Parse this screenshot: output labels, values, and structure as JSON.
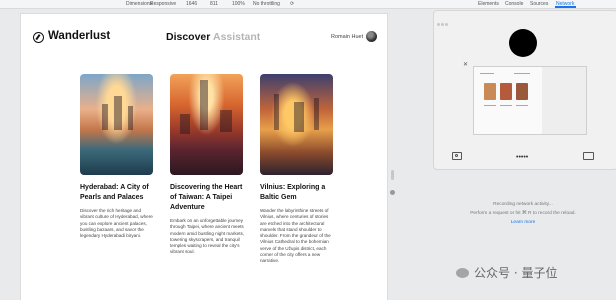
{
  "devtools": {
    "dimensions_label": "Dimensions:",
    "dimensions_value": "Responsive",
    "width": "1646",
    "height": "811",
    "zoom": "100%",
    "throttling": "No throttling",
    "tabs": [
      "Elements",
      "Console",
      "Sources",
      "Network"
    ],
    "active_tab": "Network"
  },
  "site": {
    "brand": "Wanderlust",
    "nav": {
      "discover": "Discover",
      "assistant": "Assistant"
    },
    "user": "Romain Huet"
  },
  "cards": [
    {
      "title": "Hyderabad: A City of Pearls and Palaces",
      "description": "Discover the rich heritage and vibrant culture of Hyderabad, where you can explore ancient palaces, bustling bazaars, and savor the legendary Hyderabadi biryani."
    },
    {
      "title": "Discovering the Heart of Taiwan: A Taipei Adventure",
      "description": "Embark on an unforgettable journey through Taipei, where ancient meets modern amid bustling night markets, towering skyscrapers, and tranquil temples waiting to reveal the city's vibrant soul."
    },
    {
      "title": "Vilnius: Exploring a Baltic Gem",
      "description": "Wander the labyrinthine streets of Vilnius, where centuries of stories are etched into the architectural marvels that stand shoulder to shoulder. From the grandeur of the Vilnius Cathedral to the bohemian verve of the Užupis district, each corner of the city offers a new narrative."
    }
  ],
  "network_panel": {
    "recording": "Recording network activity...",
    "hint": "Perform a request or hit ⌘ R to record the reload.",
    "learn_more": "Learn more"
  },
  "watermark": {
    "text": "公众号 · 量子位"
  }
}
